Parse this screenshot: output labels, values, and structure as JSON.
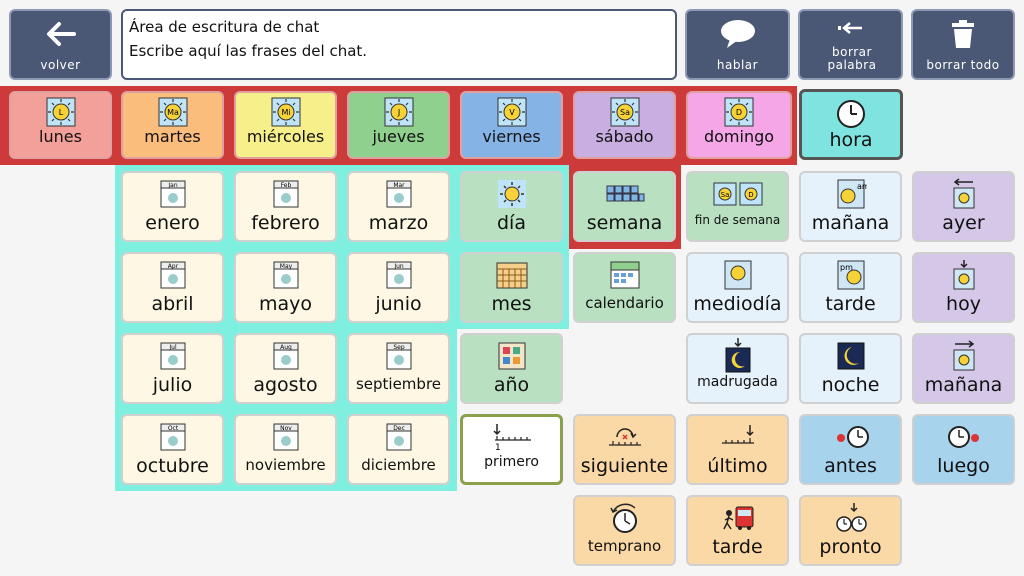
{
  "topbar": {
    "back": "volver",
    "chat_line1": "Área de escritura de chat",
    "chat_line2": "Escribe aquí las frases del chat.",
    "speak": "hablar",
    "delete_word": "borrar palabra",
    "delete_all": "borrar todo"
  },
  "days": [
    {
      "label": "lunes",
      "abbr": "L",
      "color": "#f3a09a"
    },
    {
      "label": "martes",
      "abbr": "Ma",
      "color": "#fbbd7c"
    },
    {
      "label": "miércoles",
      "abbr": "Mi",
      "color": "#f6ef8a"
    },
    {
      "label": "jueves",
      "abbr": "J",
      "color": "#8fd08f"
    },
    {
      "label": "viernes",
      "abbr": "V",
      "color": "#86b3e6"
    },
    {
      "label": "sábado",
      "abbr": "Sa",
      "color": "#c9aee2"
    },
    {
      "label": "domingo",
      "abbr": "D",
      "color": "#f4a6e6"
    }
  ],
  "hora": "hora",
  "months": [
    {
      "label": "enero",
      "abbr": "Jan"
    },
    {
      "label": "febrero",
      "abbr": "Feb"
    },
    {
      "label": "marzo",
      "abbr": "Mar"
    },
    {
      "label": "abril",
      "abbr": "Apr"
    },
    {
      "label": "mayo",
      "abbr": "May"
    },
    {
      "label": "junio",
      "abbr": "Jun"
    },
    {
      "label": "julio",
      "abbr": "Jul"
    },
    {
      "label": "agosto",
      "abbr": "Aug"
    },
    {
      "label": "septiembre",
      "abbr": "Sep"
    },
    {
      "label": "octubre",
      "abbr": "Oct"
    },
    {
      "label": "noviembre",
      "abbr": "Nov"
    },
    {
      "label": "diciembre",
      "abbr": "Dec"
    }
  ],
  "periods": {
    "dia": "día",
    "semana": "semana",
    "fin_de_semana": "fin de semana",
    "mes": "mes",
    "calendario": "calendario",
    "ano": "año",
    "fin_icon_left": "Sa",
    "fin_icon_right": "D"
  },
  "times": {
    "manana": "mañana",
    "mediodia": "mediodía",
    "tarde": "tarde",
    "madrugada": "madrugada",
    "noche": "noche",
    "am": "am",
    "pm": "pm"
  },
  "relative": {
    "ayer": "ayer",
    "hoy": "hoy",
    "manana": "mañana"
  },
  "sequence": {
    "primero": "primero",
    "primero_num": "1",
    "siguiente": "siguiente",
    "ultimo": "último",
    "antes": "antes",
    "luego": "luego",
    "temprano": "temprano",
    "tarde": "tarde",
    "pronto": "pronto"
  },
  "colors": {
    "topbar_button": "#4a5876",
    "days_band": "#cc3a3a",
    "months_band": "#7ff0df",
    "hora": "#7fe3df"
  }
}
